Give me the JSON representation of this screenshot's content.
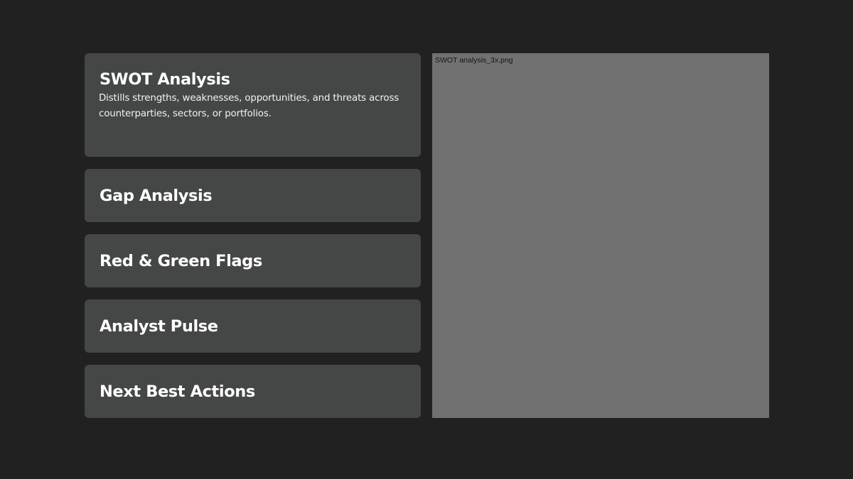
{
  "sections": [
    {
      "title": "SWOT Analysis",
      "description": "Distills strengths, weaknesses, opportunities, and threats across counterparties, sectors, or portfolios.",
      "expanded": true
    },
    {
      "title": "Gap Analysis",
      "expanded": false
    },
    {
      "title": "Red & Green Flags",
      "expanded": false
    },
    {
      "title": "Analyst Pulse",
      "expanded": false
    },
    {
      "title": "Next Best Actions",
      "expanded": false
    }
  ],
  "preview": {
    "image_alt": "SWOT analysis_3x.png"
  },
  "colors": {
    "background": "#202120",
    "card": "#454746",
    "preview": "#717171"
  }
}
